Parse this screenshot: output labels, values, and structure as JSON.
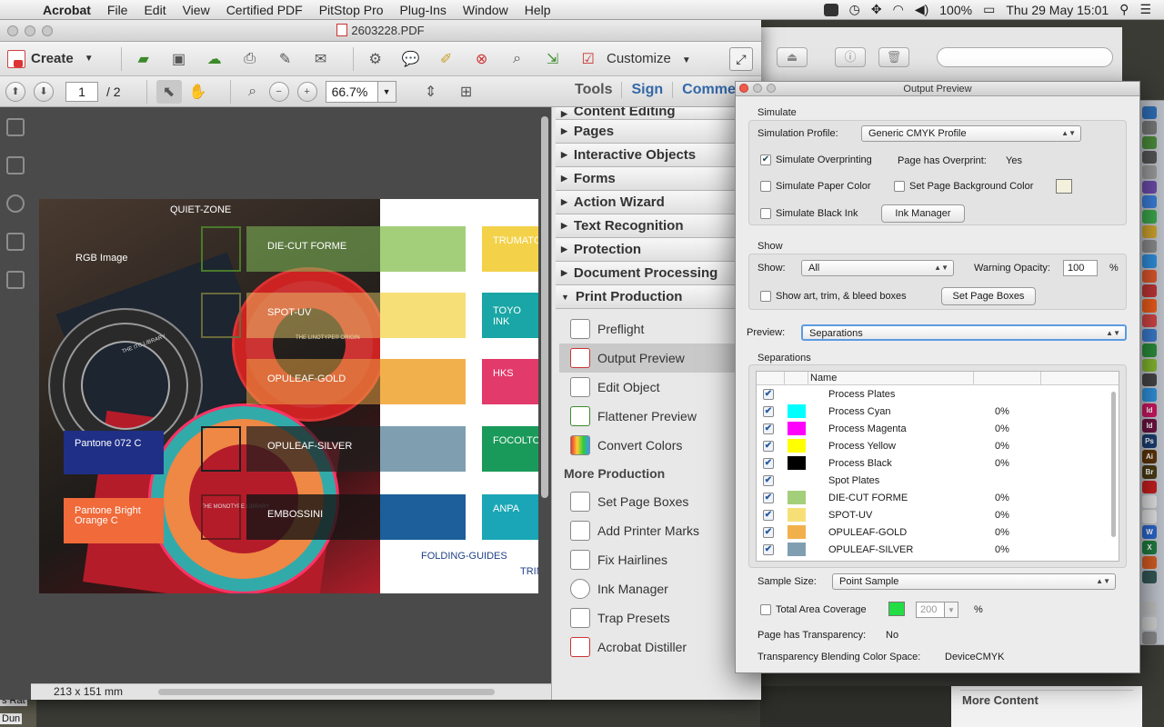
{
  "menubar": {
    "app": "Acrobat",
    "items": [
      "File",
      "Edit",
      "View",
      "Certified PDF",
      "PitStop Pro",
      "Plug-Ins",
      "Window",
      "Help"
    ],
    "battery": "100%",
    "datetime": "Thu 29 May  15:01"
  },
  "acrobat": {
    "window_title": "2603228.PDF",
    "create_label": "Create",
    "customize_label": "Customize",
    "page_current": "1",
    "page_total": "/ 2",
    "zoom": "66.7%",
    "tabs": [
      "Tools",
      "Sign",
      "Comme"
    ],
    "page_size": "213 x 151 mm"
  },
  "document": {
    "labels": {
      "quiet_zone": "QUIET-ZONE",
      "rgb_image": "RGB Image",
      "pantone_072": "Pantone 072 C",
      "pantone_orange": "Pantone Bright Orange C",
      "die_cut": "DIE-CUT FORME",
      "spot_uv": "SPOT-UV",
      "opuleaf_gold": "OPULEAF-GOLD",
      "opuleaf_silver": "OPULEAF-SILVER",
      "embossing": "EMBOSSINI",
      "folding_guides": "FOLDING-GUIDES",
      "trim": "TRIM",
      "trumato": "TRUMATC",
      "toyo": "TOYO INK",
      "hks": "HKS",
      "focoltone": "FOCOLTO",
      "anpa": "ANPA",
      "itc_library": "THE ITC LIBRARY",
      "linotype": "THE LINOTYPE® ORIGIN",
      "monotype": "THE MONOTYPE LIBRARY"
    }
  },
  "tools_panel": {
    "sections": [
      "Content Editing",
      "Pages",
      "Interactive Objects",
      "Forms",
      "Action Wizard",
      "Text Recognition",
      "Protection",
      "Document Processing"
    ],
    "open_section": "Print Production",
    "print_tools": [
      "Preflight",
      "Output Preview",
      "Edit Object",
      "Flattener Preview",
      "Convert Colors"
    ],
    "selected_tool": "Output Preview",
    "more_heading": "More Production",
    "more_tools": [
      "Set Page Boxes",
      "Add Printer Marks",
      "Fix Hairlines",
      "Ink Manager",
      "Trap Presets",
      "Acrobat Distiller"
    ]
  },
  "output_preview": {
    "title": "Output Preview",
    "simulate_label": "Simulate",
    "sim_profile_label": "Simulation Profile:",
    "sim_profile_value": "Generic CMYK Profile",
    "sim_overprint_label": "Simulate Overprinting",
    "sim_overprint_checked": true,
    "page_overprint_label": "Page has Overprint:",
    "page_overprint_value": "Yes",
    "sim_paper_label": "Simulate Paper Color",
    "set_bg_label": "Set Page Background Color",
    "sim_black_label": "Simulate Black Ink",
    "ink_manager_label": "Ink Manager",
    "show_group_label": "Show",
    "show_label": "Show:",
    "show_value": "All",
    "warning_opacity_label": "Warning Opacity:",
    "warning_opacity_value": "100",
    "percent": "%",
    "show_boxes_label": "Show art, trim, & bleed boxes",
    "set_page_boxes_label": "Set Page Boxes",
    "preview_label": "Preview:",
    "preview_value": "Separations",
    "separations_label": "Separations",
    "name_header": "Name",
    "separations": [
      {
        "name": "Process Plates",
        "color": "",
        "pct": ""
      },
      {
        "name": "Process Cyan",
        "color": "#00ffff",
        "pct": "0%"
      },
      {
        "name": "Process Magenta",
        "color": "#ff00ff",
        "pct": "0%"
      },
      {
        "name": "Process Yellow",
        "color": "#ffff00",
        "pct": "0%"
      },
      {
        "name": "Process Black",
        "color": "#000000",
        "pct": "0%"
      },
      {
        "name": "Spot Plates",
        "color": "",
        "pct": ""
      },
      {
        "name": "DIE-CUT FORME",
        "color": "#a3cf7a",
        "pct": "0%"
      },
      {
        "name": "SPOT-UV",
        "color": "#f7df78",
        "pct": "0%"
      },
      {
        "name": "OPULEAF-GOLD",
        "color": "#f2b04c",
        "pct": "0%"
      },
      {
        "name": "OPULEAF-SILVER",
        "color": "#7f9fb0",
        "pct": "0%"
      }
    ],
    "sample_size_label": "Sample Size:",
    "sample_size_value": "Point Sample",
    "tac_label": "Total Area Coverage",
    "tac_value": "200",
    "tac_color": "#22dd44",
    "transparency_label": "Page has Transparency:",
    "transparency_value": "No",
    "blend_space_label": "Transparency Blending Color Space:",
    "blend_space_value": "DeviceCMYK"
  },
  "background": {
    "more_content": "More Content"
  },
  "colors": {
    "accent": "#3368a8",
    "pantone_072": "#1f2f86",
    "pantone_orange": "#f06a3a"
  }
}
